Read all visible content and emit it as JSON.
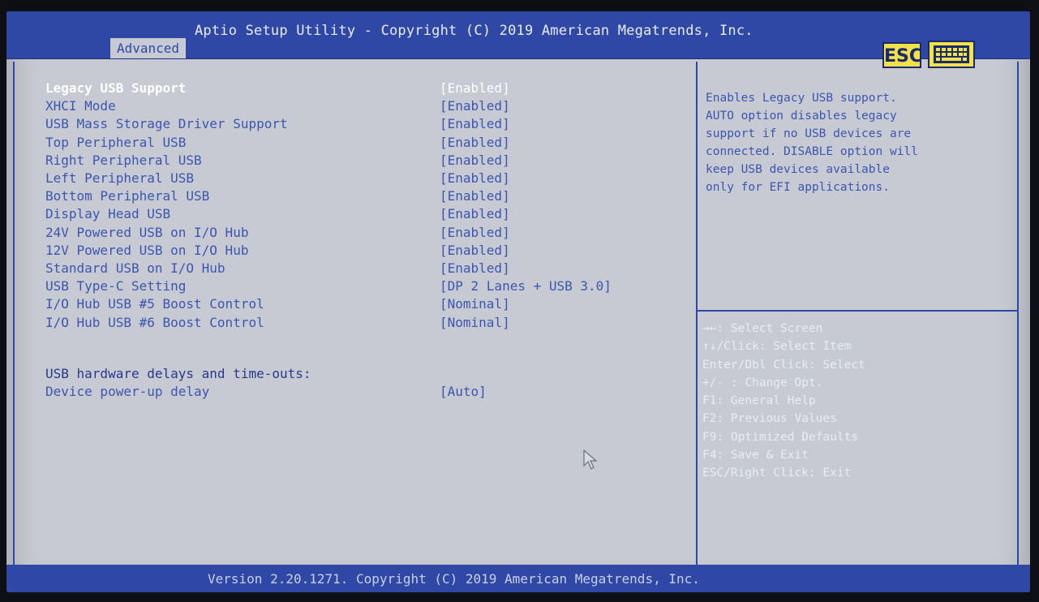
{
  "header": {
    "title": "Aptio Setup Utility - Copyright (C) 2019 American Megatrends, Inc.",
    "tab": "Advanced",
    "esc_label": "ESC",
    "keyboard_icon": "keyboard-icon"
  },
  "settings": [
    {
      "label": "Legacy USB Support",
      "value": "[Enabled]",
      "selected": true
    },
    {
      "label": "XHCI Mode",
      "value": "[Enabled]"
    },
    {
      "label": "USB Mass Storage Driver Support",
      "value": "[Enabled]"
    },
    {
      "label": "Top Peripheral USB",
      "value": "[Enabled]"
    },
    {
      "label": "Right Peripheral USB",
      "value": "[Enabled]"
    },
    {
      "label": "Left Peripheral USB",
      "value": "[Enabled]"
    },
    {
      "label": "Bottom Peripheral USB",
      "value": "[Enabled]"
    },
    {
      "label": "Display Head USB",
      "value": "[Enabled]"
    },
    {
      "label": "24V Powered USB on I/O Hub",
      "value": "[Enabled]"
    },
    {
      "label": "12V Powered USB on I/O Hub",
      "value": "[Enabled]"
    },
    {
      "label": "Standard USB on I/O Hub",
      "value": "[Enabled]"
    },
    {
      "label": "USB Type-C Setting",
      "value": "[DP 2 Lanes + USB 3.0]"
    },
    {
      "label": "I/O Hub USB #5 Boost Control",
      "value": "[Nominal]"
    },
    {
      "label": "I/O Hub USB #6 Boost Control",
      "value": "[Nominal]"
    }
  ],
  "delays": {
    "section_label": "USB hardware delays and time-outs:",
    "device_label": "Device power-up delay",
    "device_value": "[Auto]"
  },
  "help": {
    "description": "Enables Legacy USB support.\nAUTO option disables legacy\nsupport if no USB devices are\nconnected. DISABLE option will\nkeep USB devices available\nonly for EFI applications.",
    "keys": [
      "→←: Select Screen",
      "↑↓/Click: Select Item",
      "Enter/Dbl Click: Select",
      "+/- : Change Opt.",
      "F1: General Help",
      "F2: Previous Values",
      "F9: Optimized Defaults",
      "F4: Save & Exit",
      "ESC/Right Click: Exit"
    ]
  },
  "footer": {
    "version": "Version 2.20.1271. Copyright (C) 2019 American Megatrends, Inc."
  },
  "colors": {
    "accent": "#2f48a6",
    "panel": "#c7cad2",
    "selected_text": "#ffffff",
    "option_text": "#3c56b0",
    "esc_button": "#f2e24a"
  }
}
